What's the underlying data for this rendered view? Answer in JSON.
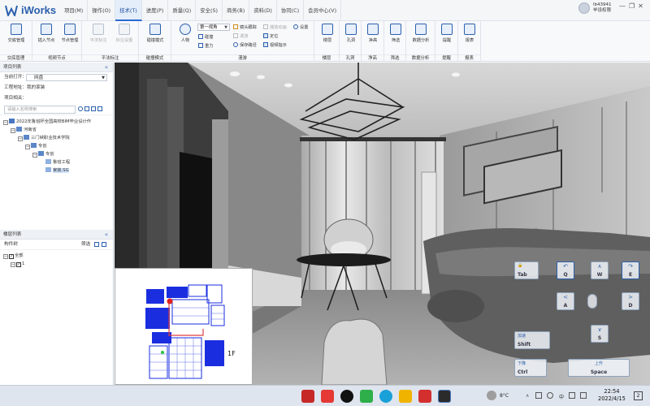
{
  "app": {
    "name": "iWorks"
  },
  "menu_tabs": [
    "项目(M)",
    "操作(O)",
    "技术(T)",
    "进度(P)",
    "质量(Q)",
    "安全(S)",
    "商务(B)",
    "资料(D)",
    "协同(C)",
    "会员中心(V)"
  ],
  "active_tab": "技术(T)",
  "user": {
    "id": "lb43941",
    "role": "毕设权限"
  },
  "window_controls": [
    "—",
    "❐",
    "✕"
  ],
  "ribbon": {
    "groups": [
      {
        "label": "交底管理",
        "buttons": [
          "交底管理"
        ]
      },
      {
        "label": "视频节点",
        "buttons": [
          "插入节点",
          "节点管理"
        ]
      },
      {
        "label": "平法标注",
        "buttons": [
          "平法标注",
          "标注设置"
        ]
      },
      {
        "label": "碰撞模式",
        "buttons": [
          "碰撞模式"
        ]
      },
      {
        "label": "漫游",
        "buttons": [
          "人物"
        ]
      },
      {
        "label": "楼层",
        "buttons": [
          "楼层"
        ]
      },
      {
        "label": "孔洞",
        "buttons": [
          "孔洞"
        ]
      },
      {
        "label": "净高",
        "buttons": [
          "净高"
        ]
      },
      {
        "label": "筛选",
        "buttons": [
          "筛选"
        ]
      },
      {
        "label": "数据分析",
        "buttons": [
          "数据分析"
        ]
      },
      {
        "label": "提醒",
        "buttons": [
          "提醒"
        ]
      },
      {
        "label": "报表",
        "buttons": [
          "报表"
        ]
      }
    ],
    "roam": {
      "view_select": "第一视角",
      "options": [
        "碰撞",
        "重力"
      ],
      "items_col1": [
        "镜头跟踪",
        "漫游",
        "保存路径"
      ],
      "items_col2": [
        "播放动画",
        "定位",
        "视频指示"
      ],
      "settings": "设置"
    }
  },
  "left_panel": {
    "project_list_title": "项目列表",
    "open_label": "当前打开：",
    "open_value": "网盘",
    "project_name_label": "工程地址：",
    "project_name_value": "我的家装",
    "project_related_label": "项目相关：",
    "search_placeholder": "请输入名称搜索",
    "tree": [
      {
        "level": 0,
        "label": "2022年鲁班杯全国高校BIM毕业设计作"
      },
      {
        "level": 1,
        "label": "河南省"
      },
      {
        "level": 2,
        "label": "三门峡职业技术学院"
      },
      {
        "level": 3,
        "label": "专创"
      },
      {
        "level": 4,
        "label": "专创"
      },
      {
        "level": 5,
        "label": "鲁班工程"
      },
      {
        "level": 5,
        "label": "家装.SG"
      }
    ],
    "layer_list_title": "楼层列表",
    "structure_label": "构件树",
    "filter_label": "筛选",
    "layer_tree": [
      {
        "level": 0,
        "label": "全部"
      },
      {
        "level": 1,
        "label": "1"
      }
    ]
  },
  "viewport": {
    "minimap_floor": "1F"
  },
  "keyboard": {
    "tab": {
      "label": "",
      "key": "Tab"
    },
    "q": {
      "label": "",
      "key": "Q"
    },
    "w": {
      "label": "∧",
      "key": "W"
    },
    "e": {
      "label": "",
      "key": "E"
    },
    "a": {
      "label": "<",
      "key": "A"
    },
    "d": {
      "label": ">",
      "key": "D"
    },
    "s": {
      "label": "∨",
      "key": "S"
    },
    "shift": {
      "label": "加速",
      "key": "Shift"
    },
    "ctrl": {
      "label": "下降",
      "key": "Ctrl"
    },
    "space": {
      "label": "上升",
      "key": "Space"
    }
  },
  "taskbar": {
    "tray": {
      "temp": "8°C",
      "lang": "中",
      "notif": "2"
    },
    "time": "22:54",
    "date": "2022/4/15"
  }
}
